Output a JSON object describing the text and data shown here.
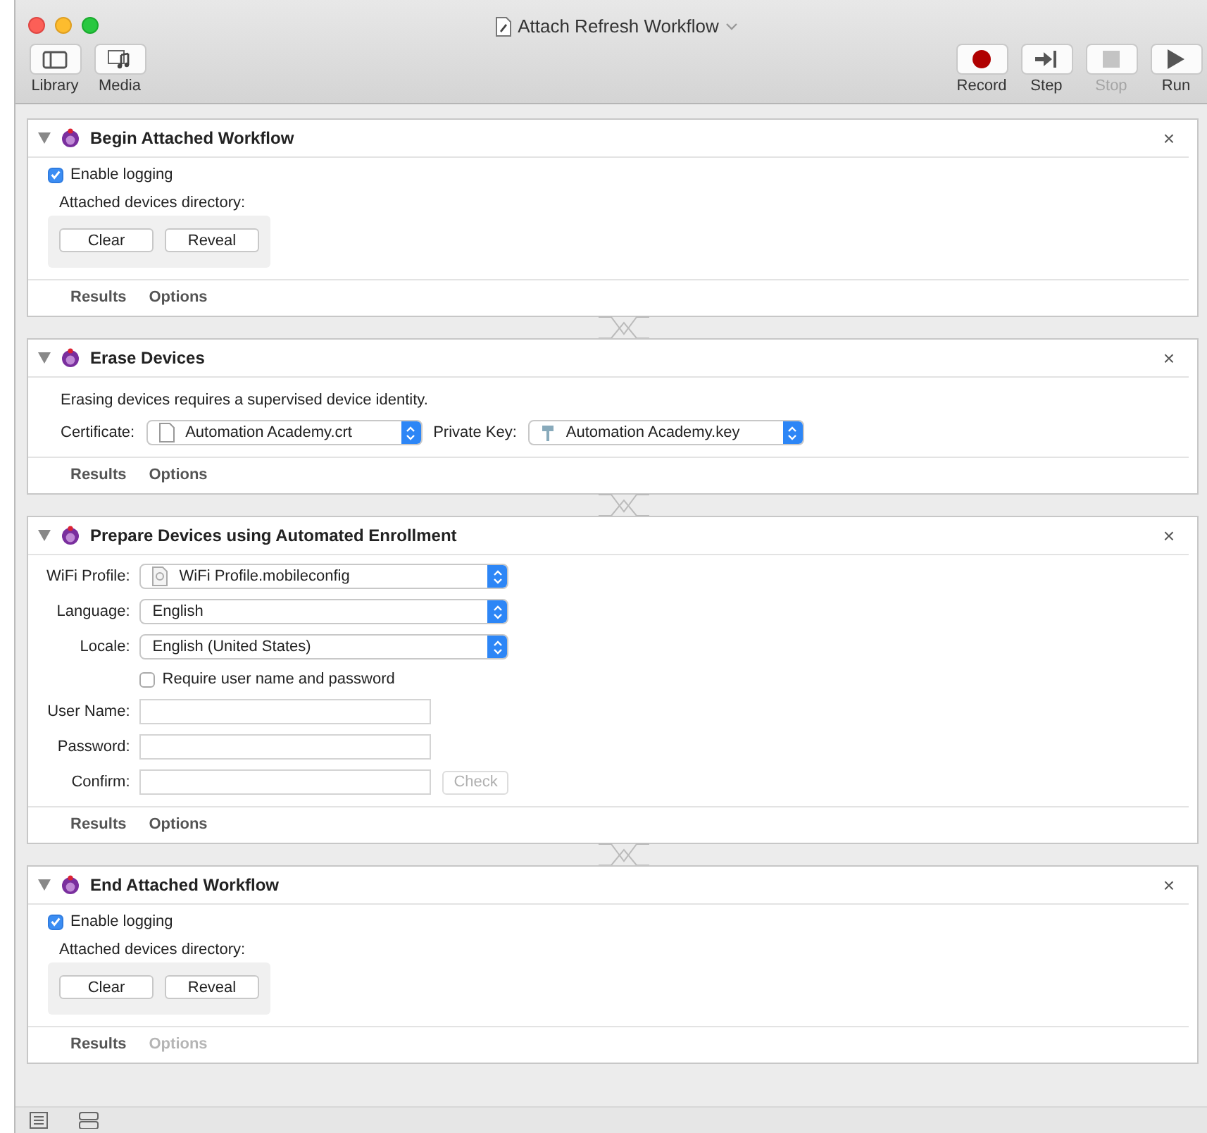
{
  "window": {
    "title": "Attach Refresh Workflow"
  },
  "toolbar_left": [
    {
      "label": "Library",
      "kind": "library"
    },
    {
      "label": "Media",
      "kind": "media"
    }
  ],
  "toolbar_right": [
    {
      "label": "Record",
      "kind": "record",
      "disabled": false
    },
    {
      "label": "Step",
      "kind": "step",
      "disabled": false
    },
    {
      "label": "Stop",
      "kind": "stop",
      "disabled": true
    },
    {
      "label": "Run",
      "kind": "run",
      "disabled": false
    }
  ],
  "actions": [
    {
      "kind": "logging",
      "title": "Begin Attached Workflow",
      "close": "×",
      "checkbox": {
        "label": "Enable logging",
        "checked": true
      },
      "directory_label": "Attached devices directory:",
      "buttons": [
        "Clear",
        "Reveal"
      ],
      "tabs": [
        {
          "label": "Results",
          "disabled": false
        },
        {
          "label": "Options",
          "disabled": false
        }
      ]
    },
    {
      "kind": "erase",
      "title": "Erase Devices",
      "close": "×",
      "note": "Erasing devices requires a supervised device identity.",
      "popups": [
        {
          "label": "Certificate:",
          "value": "Automation Academy.crt",
          "kind": "document"
        },
        {
          "label": "Private Key:",
          "value": "Automation Academy.key",
          "kind": "key"
        }
      ],
      "tabs": [
        {
          "label": "Results",
          "disabled": false
        },
        {
          "label": "Options",
          "disabled": false
        }
      ]
    },
    {
      "kind": "prepare",
      "title": "Prepare Devices using Automated Enrollment",
      "close": "×",
      "popups": [
        {
          "label": "WiFi Profile:",
          "value": "WiFi Profile.mobileconfig",
          "kind": "profile"
        },
        {
          "label": "Language:",
          "value": "English",
          "kind": "plain"
        },
        {
          "label": "Locale:",
          "value": "English (United States)",
          "kind": "plain"
        }
      ],
      "checkbox": {
        "label": "Require user name and password",
        "checked": false
      },
      "fields": [
        {
          "label": "User Name:"
        },
        {
          "label": "Password:"
        },
        {
          "label": "Confirm:"
        }
      ],
      "check_button": {
        "label": "Check",
        "disabled": true
      },
      "tabs": [
        {
          "label": "Results",
          "disabled": false
        },
        {
          "label": "Options",
          "disabled": false
        }
      ]
    },
    {
      "kind": "logging",
      "title": "End Attached Workflow",
      "close": "×",
      "checkbox": {
        "label": "Enable logging",
        "checked": true
      },
      "directory_label": "Attached devices directory:",
      "buttons": [
        "Clear",
        "Reveal"
      ],
      "tabs": [
        {
          "label": "Results",
          "disabled": false
        },
        {
          "label": "Options",
          "disabled": true
        }
      ]
    }
  ]
}
